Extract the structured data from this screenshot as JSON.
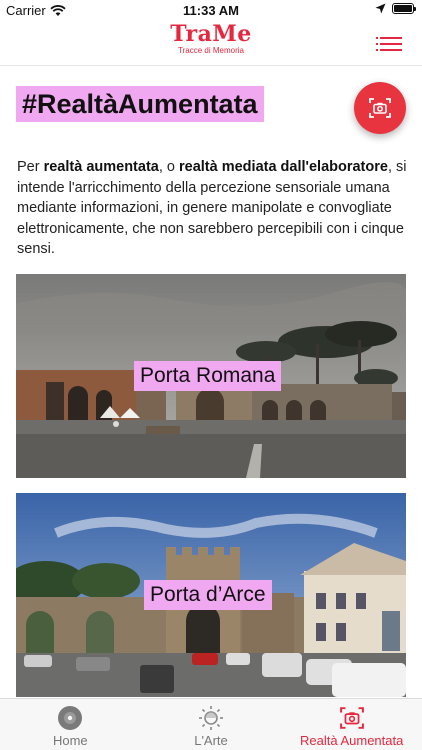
{
  "status": {
    "carrier": "Carrier",
    "time": "11:33 AM"
  },
  "header": {
    "title": "TraMe",
    "subtitle": "Tracce di Memoria"
  },
  "page": {
    "title": "#RealtàAumentata",
    "intro": {
      "p1": "Per ",
      "b1": "realtà aumentata",
      "p2": ", o ",
      "b2": "realtà mediata dall'elaboratore",
      "p3": ", si intende l'arricchimento della percezione sensoriale umana mediante informazioni, in genere manipolate e convogliate elettronicamente, che non sarebbero percepibili con i cinque sensi."
    }
  },
  "cards": [
    {
      "label": "Porta Romana"
    },
    {
      "label": "Porta d’Arce"
    }
  ],
  "tabs": [
    {
      "label": "Home",
      "icon": "home-icon"
    },
    {
      "label": "L'Arte",
      "icon": "art-icon"
    },
    {
      "label": "Realtà Aumentata",
      "icon": "camera-icon"
    }
  ],
  "colors": {
    "accent": "#e5283f",
    "highlight": "#f0a8f0",
    "fab": "#e8343f"
  }
}
